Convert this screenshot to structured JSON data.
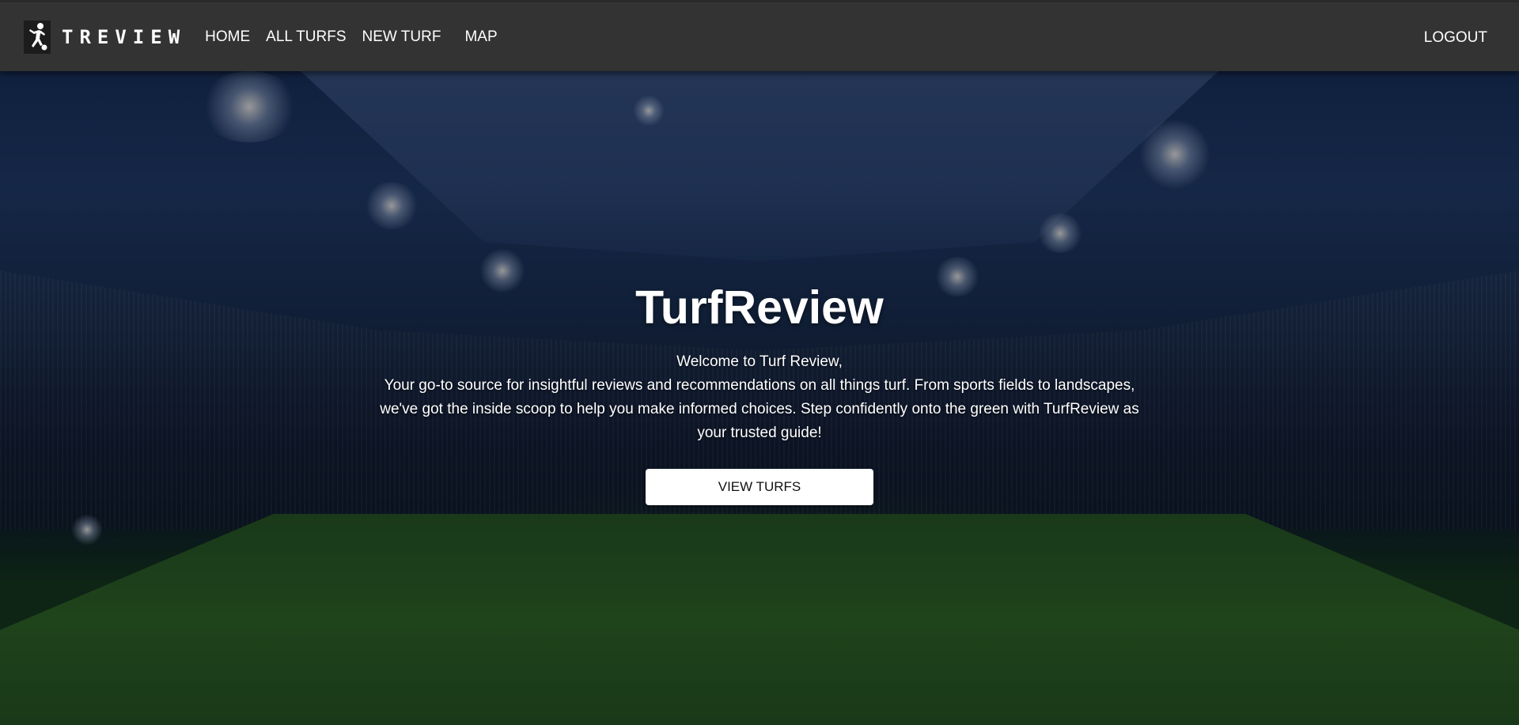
{
  "nav": {
    "brand": "TREVIEW",
    "links": [
      {
        "label": "HOME"
      },
      {
        "label": "ALL TURFS"
      },
      {
        "label": "NEW TURF"
      },
      {
        "label": "MAP"
      }
    ],
    "logout": "LOGOUT"
  },
  "hero": {
    "title": "TurfReview",
    "welcome": "Welcome to Turf Review,",
    "description": "Your go-to source for insightful reviews and recommendations on all things turf. From sports fields to landscapes, we've got the inside scoop to help you make informed choices. Step confidently onto the green with TurfReview as your trusted guide!",
    "button": "VIEW TURFS"
  },
  "colors": {
    "navbar": "#333333",
    "text": "#ffffff",
    "button_bg": "#ffffff",
    "button_text": "#111111"
  },
  "icons": {
    "brand": "soccer-player-icon"
  }
}
